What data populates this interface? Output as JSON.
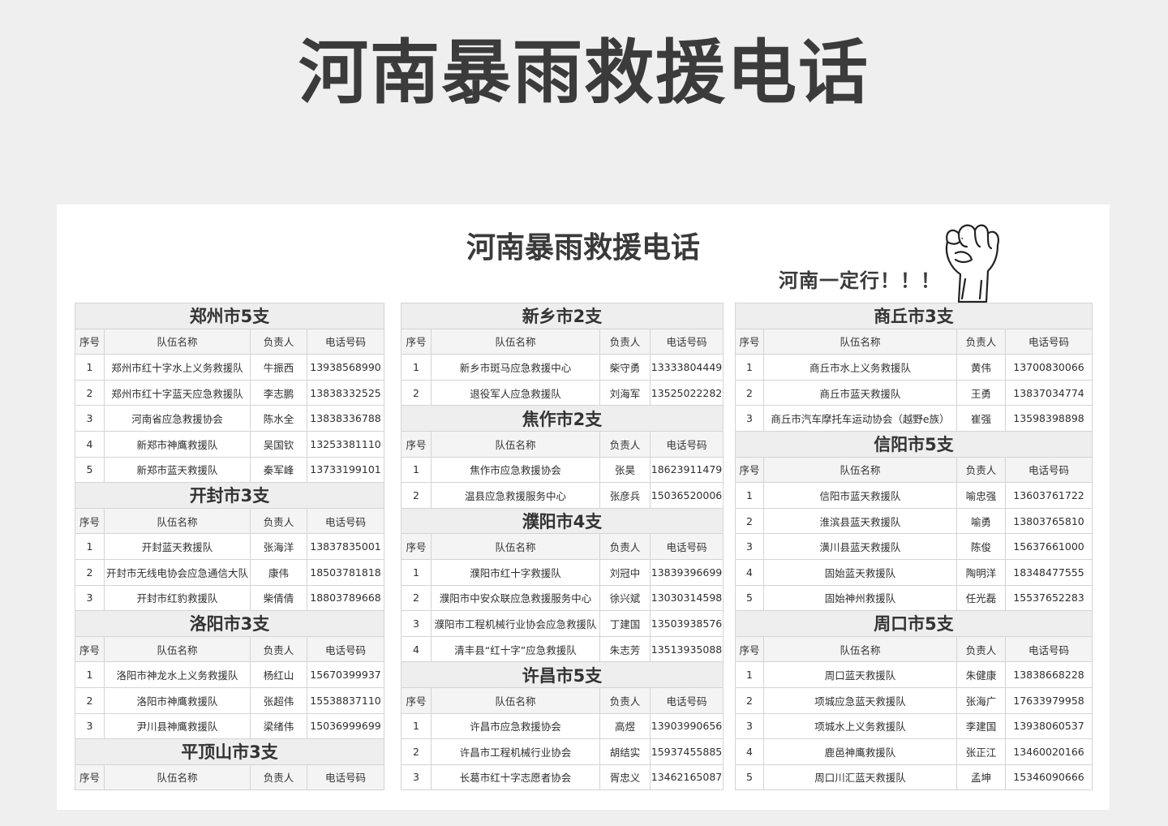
{
  "header": {
    "title": "河南暴雨救援电话"
  },
  "sheet": {
    "title": "河南暴雨救援电话",
    "slogan": "河南一定行！！！",
    "fist_icon": "raised-fist-icon"
  },
  "columns_header": {
    "no": "序号",
    "team": "队伍名称",
    "leader": "负责人",
    "phone": "电话号码"
  },
  "columns": [
    {
      "sections": [
        {
          "title": "郑州市5支",
          "rows": [
            {
              "no": "1",
              "team": "郑州市红十字水上义务救援队",
              "leader": "牛振西",
              "phone": "13938568990"
            },
            {
              "no": "2",
              "team": "郑州市红十字蓝天应急救援队",
              "leader": "李志鹏",
              "phone": "13838332525"
            },
            {
              "no": "3",
              "team": "河南省应急救援协会",
              "leader": "陈水全",
              "phone": "13838336788"
            },
            {
              "no": "4",
              "team": "新郑市神鹰救援队",
              "leader": "吴国钦",
              "phone": "13253381110"
            },
            {
              "no": "5",
              "team": "新郑市蓝天救援队",
              "leader": "秦军峰",
              "phone": "13733199101"
            }
          ]
        },
        {
          "title": "开封市3支",
          "rows": [
            {
              "no": "1",
              "team": "开封蓝天救援队",
              "leader": "张海洋",
              "phone": "13837835001"
            },
            {
              "no": "2",
              "team": "开封市无线电协会应急通信大队",
              "leader": "康伟",
              "phone": "18503781818"
            },
            {
              "no": "3",
              "team": "开封市红豹救援队",
              "leader": "柴倩倩",
              "phone": "18803789668"
            }
          ]
        },
        {
          "title": "洛阳市3支",
          "rows": [
            {
              "no": "1",
              "team": "洛阳市神龙水上义务救援队",
              "leader": "杨红山",
              "phone": "15670399937"
            },
            {
              "no": "2",
              "team": "洛阳市神鹰救援队",
              "leader": "张超伟",
              "phone": "15538837110"
            },
            {
              "no": "3",
              "team": "尹川县神鹰救援队",
              "leader": "梁绪伟",
              "phone": "15036999699"
            }
          ]
        },
        {
          "title": "平顶山市3支",
          "rows": []
        }
      ]
    },
    {
      "sections": [
        {
          "title": "新乡市2支",
          "rows": [
            {
              "no": "1",
              "team": "新乡市斑马应急救援中心",
              "leader": "柴守勇",
              "phone": "13333804449"
            },
            {
              "no": "2",
              "team": "退役军人应急救援队",
              "leader": "刘海军",
              "phone": "13525022282"
            }
          ]
        },
        {
          "title": "焦作市2支",
          "rows": [
            {
              "no": "1",
              "team": "焦作市应急救援协会",
              "leader": "张昊",
              "phone": "18623911479"
            },
            {
              "no": "2",
              "team": "温县应急救援服务中心",
              "leader": "张彦兵",
              "phone": "15036520006"
            }
          ]
        },
        {
          "title": "濮阳市4支",
          "rows": [
            {
              "no": "1",
              "team": "濮阳市红十字救援队",
              "leader": "刘冠中",
              "phone": "13839396699"
            },
            {
              "no": "2",
              "team": "濮阳市中安众联应急救援服务中心",
              "leader": "徐兴斌",
              "phone": "13030314598"
            },
            {
              "no": "3",
              "team": "濮阳市工程机械行业协会应急救援队",
              "leader": "丁建国",
              "phone": "13503938576"
            },
            {
              "no": "4",
              "team": "清丰县“红十字”应急救援队",
              "leader": "朱志芳",
              "phone": "13513935088"
            }
          ]
        },
        {
          "title": "许昌市5支",
          "rows": [
            {
              "no": "1",
              "team": "许昌市应急救援协会",
              "leader": "高煜",
              "phone": "13903990656"
            },
            {
              "no": "2",
              "team": "许昌市工程机械行业协会",
              "leader": "胡结实",
              "phone": "15937455885"
            },
            {
              "no": "3",
              "team": "长葛市红十字志愿者协会",
              "leader": "胥忠义",
              "phone": "13462165087"
            }
          ]
        }
      ]
    },
    {
      "sections": [
        {
          "title": "商丘市3支",
          "rows": [
            {
              "no": "1",
              "team": "商丘市水上义务救援队",
              "leader": "黄伟",
              "phone": "13700830066"
            },
            {
              "no": "2",
              "team": "商丘市蓝天救援队",
              "leader": "王勇",
              "phone": "13837034774"
            },
            {
              "no": "3",
              "team": "商丘市汽车摩托车运动协会（越野e族）",
              "leader": "崔强",
              "phone": "13598398898"
            }
          ]
        },
        {
          "title": "信阳市5支",
          "rows": [
            {
              "no": "1",
              "team": "信阳市蓝天救援队",
              "leader": "喻忠强",
              "phone": "13603761722"
            },
            {
              "no": "2",
              "team": "淮滨县蓝天救援队",
              "leader": "喻勇",
              "phone": "13803765810"
            },
            {
              "no": "3",
              "team": "潢川县蓝天救援队",
              "leader": "陈俊",
              "phone": "15637661000"
            },
            {
              "no": "4",
              "team": "固始蓝天救援队",
              "leader": "陶明洋",
              "phone": "18348477555"
            },
            {
              "no": "5",
              "team": "固始神州救援队",
              "leader": "任光磊",
              "phone": "15537652283"
            }
          ]
        },
        {
          "title": "周口市5支",
          "rows": [
            {
              "no": "1",
              "team": "周口蓝天救援队",
              "leader": "朱健康",
              "phone": "13838668228"
            },
            {
              "no": "2",
              "team": "项城应急蓝天救援队",
              "leader": "张海广",
              "phone": "17633979958"
            },
            {
              "no": "3",
              "team": "项城水上义务救援队",
              "leader": "李建国",
              "phone": "13938060537"
            },
            {
              "no": "4",
              "team": "鹿邑神鹰救援队",
              "leader": "张正江",
              "phone": "13460020166"
            },
            {
              "no": "5",
              "team": "周口川汇蓝天救援队",
              "leader": "孟坤",
              "phone": "15346090666"
            }
          ]
        }
      ]
    }
  ]
}
